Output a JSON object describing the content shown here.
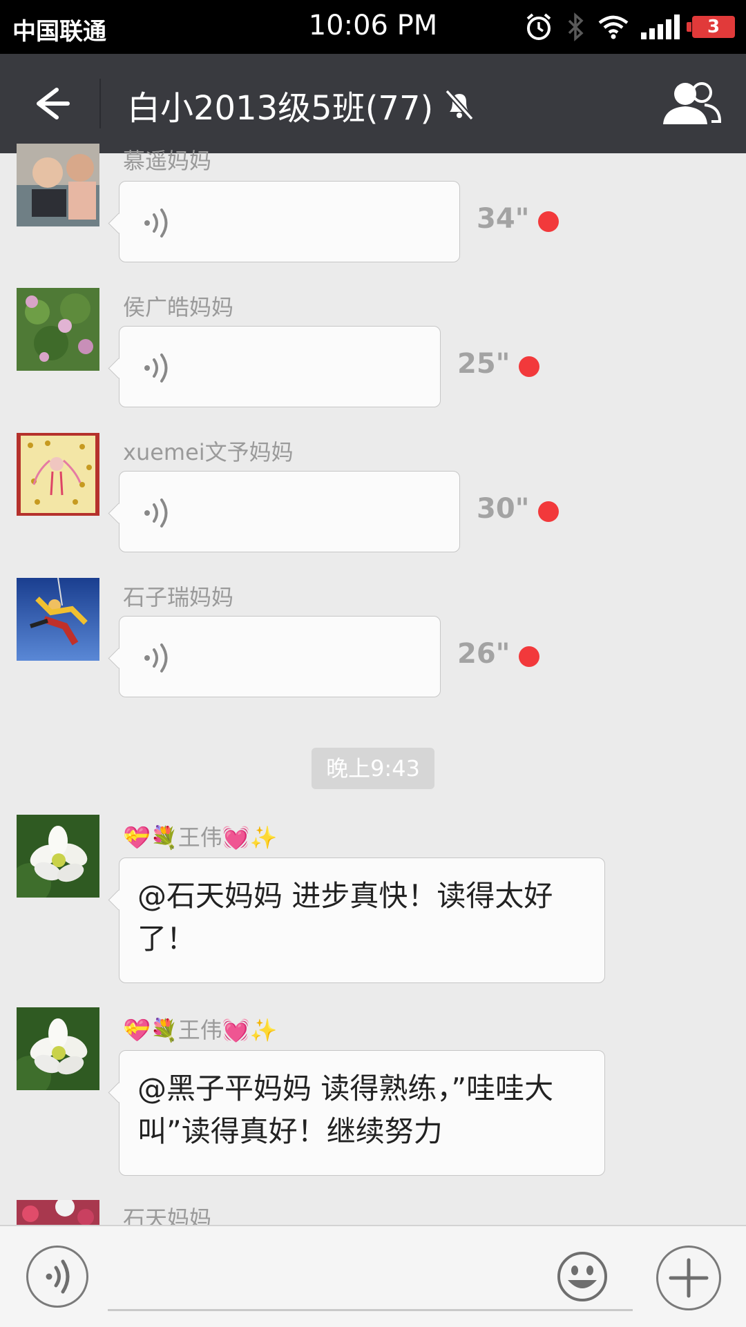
{
  "status_bar": {
    "carrier": "中国联通",
    "time": "10:06 PM",
    "battery": "3",
    "icons": [
      "alarm-icon",
      "bluetooth-icon",
      "wifi-icon",
      "signal-icon",
      "battery-icon"
    ]
  },
  "header": {
    "title": "白小2013级5班(77)",
    "back_icon": "back-arrow-icon",
    "mute_icon": "bell-muted-icon",
    "members_icon": "group-icon"
  },
  "messages": [
    {
      "sender": "慕遥妈妈",
      "type": "voice",
      "duration": "34\"",
      "unread": true
    },
    {
      "sender": "侯广皓妈妈",
      "type": "voice",
      "duration": "25\"",
      "unread": true
    },
    {
      "sender": "xuemei文予妈妈",
      "type": "voice",
      "duration": "30\"",
      "unread": true
    },
    {
      "sender": "石子瑞妈妈",
      "type": "voice",
      "duration": "26\"",
      "unread": true
    }
  ],
  "time_divider": "晚上9:43",
  "text_messages": [
    {
      "sender": "💝💐王伟💓✨",
      "text": "@石天妈妈 进步真快！读得太好了！"
    },
    {
      "sender": "💝💐王伟💓✨",
      "text": "@黑子平妈妈 读得熟练，”哇哇大叫”读得真好！继续努力"
    }
  ],
  "partial_sender": "石天妈妈",
  "input_bar": {
    "voice_icon": "voice-toggle-icon",
    "emoji_icon": "emoji-icon",
    "plus_icon": "plus-icon",
    "placeholder": ""
  },
  "colors": {
    "header_bg": "#393a3f",
    "chat_bg": "#ebebeb",
    "unread_dot": "#f2393b"
  }
}
